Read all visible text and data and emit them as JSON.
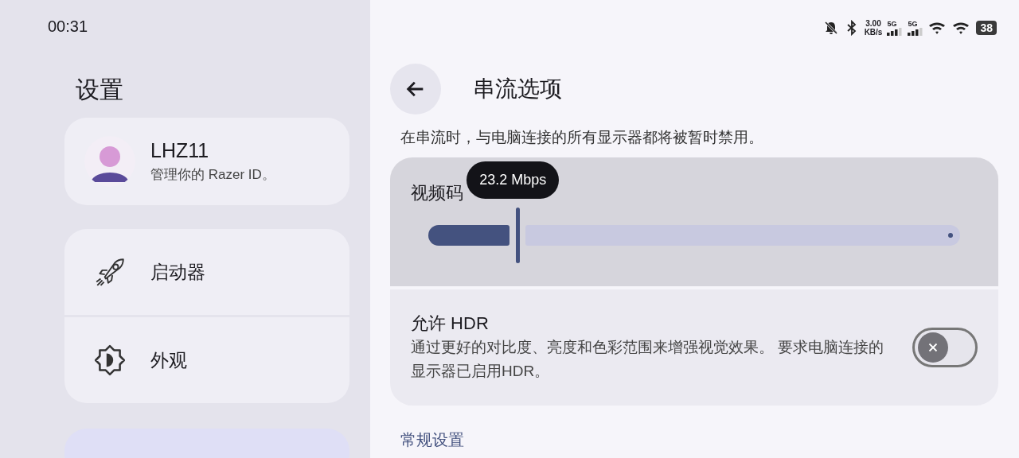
{
  "status_bar": {
    "time": "00:31",
    "speed_value": "3.00",
    "speed_unit": "KB/s",
    "signals": [
      {
        "label": "5G"
      },
      {
        "label": "5G"
      }
    ],
    "battery": "38"
  },
  "sidebar": {
    "title": "设置",
    "account": {
      "name": "LHZ11",
      "subtitle": "管理你的 Razer ID。"
    },
    "items": [
      {
        "label": "启动器",
        "selected": false
      },
      {
        "label": "外观",
        "selected": false
      }
    ],
    "next_item": {
      "selected": true
    }
  },
  "page": {
    "title": "串流选项",
    "description": "在串流时，与电脑连接的所有显示器都将被暂时禁用。",
    "bitrate": {
      "label": "视频码",
      "tooltip": "23.2 Mbps",
      "level": 0.168
    },
    "hdr": {
      "title": "允许 HDR",
      "description": "通过更好的对比度、亮度和色彩范围来增强视觉效果。 要求电脑连接的显示器已启用HDR。",
      "on": false
    },
    "section_header": "常规设置"
  }
}
